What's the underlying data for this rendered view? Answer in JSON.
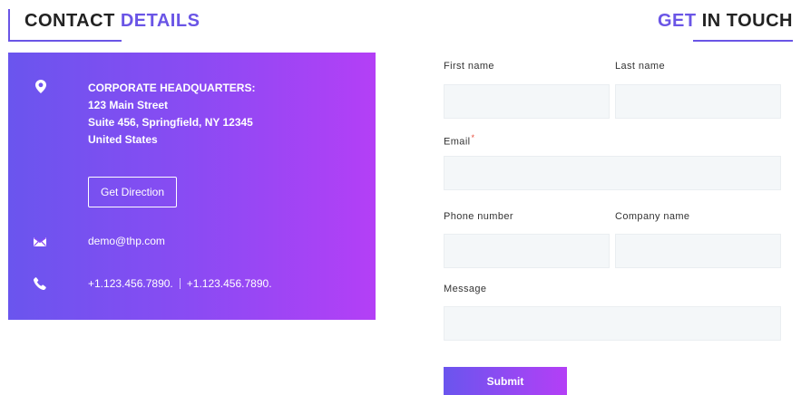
{
  "contact_heading": {
    "part1": "CONTACT",
    "part2": "DETAILS"
  },
  "touch_heading": {
    "part1": "GET",
    "part2": "IN TOUCH"
  },
  "address": {
    "title": "CORPORATE HEADQUARTERS:",
    "line1": "123 Main Street",
    "line2": "Suite 456, Springfield, NY 12345",
    "line3": "United States",
    "icon": "map-marker-icon"
  },
  "direction_button": "Get Direction",
  "email": {
    "value": "demo@thp.com",
    "icon": "envelope-icon"
  },
  "phone": {
    "value1": "+1.123.456.7890.",
    "value2": "+1.123.456.7890.",
    "icon": "phone-icon"
  },
  "form": {
    "first_name_label": "First name",
    "last_name_label": "Last name",
    "email_label": "Email",
    "email_required": "*",
    "phone_label": "Phone number",
    "company_label": "Company name",
    "message_label": "Message",
    "submit_label": "Submit"
  },
  "colors": {
    "accent": "#6a55e6",
    "gradient_start": "#6a55ee",
    "gradient_end": "#b43ff6",
    "field_bg": "#f4f7f9"
  }
}
